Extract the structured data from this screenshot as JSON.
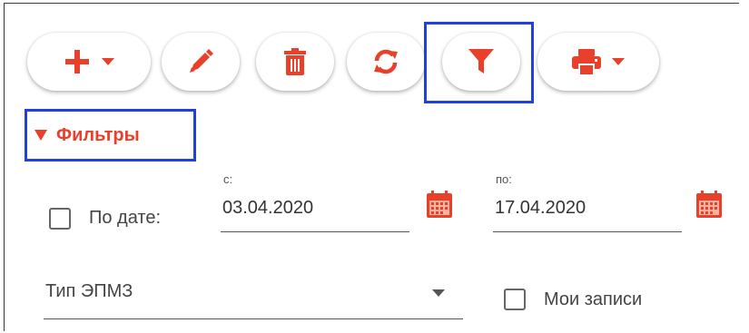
{
  "colors": {
    "accent": "#e8402a",
    "highlight": "#2040e0"
  },
  "toolbar": {
    "buttons": [
      {
        "icon": "plus-icon",
        "has_dropdown": true
      },
      {
        "icon": "pencil-icon",
        "has_dropdown": false
      },
      {
        "icon": "trash-icon",
        "has_dropdown": false
      },
      {
        "icon": "refresh-icon",
        "has_dropdown": false
      },
      {
        "icon": "filter-icon",
        "has_dropdown": false
      },
      {
        "icon": "print-icon",
        "has_dropdown": true
      }
    ]
  },
  "filters": {
    "toggle_label": "Фильтры",
    "by_date_label": "По дате:",
    "by_date_checked": false,
    "from_label": "с:",
    "from_value": "03.04.2020",
    "to_label": "по:",
    "to_value": "17.04.2020",
    "type_select_value": "Тип ЭПМЗ",
    "my_records_label": "Мои записи",
    "my_records_checked": false
  }
}
